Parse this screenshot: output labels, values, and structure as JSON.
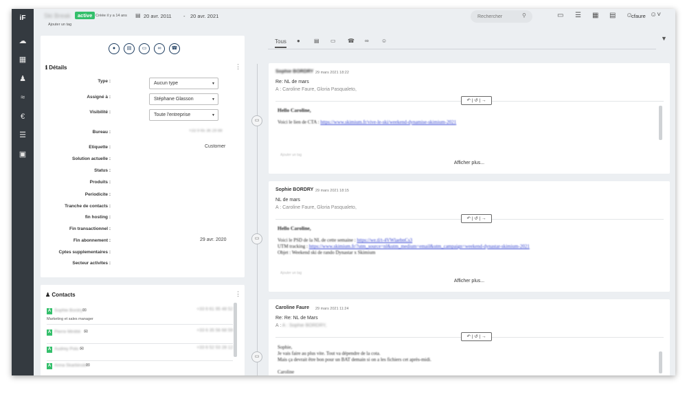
{
  "topbar": {
    "title": "Ski Break",
    "status": "active",
    "created": "Créée il y a 14 ans",
    "add_tag": "Ajouter un tag",
    "date_start": "20 avr. 2011",
    "date_sep": "-",
    "date_end": "20 avr. 2021",
    "search_placeholder": "Rechercher",
    "user": "cfaure"
  },
  "details": {
    "title": "Détails",
    "fields": [
      {
        "label": "Type :",
        "value": "Aucun type"
      },
      {
        "label": "Assigné à :",
        "value": "Stéphane Glasson"
      },
      {
        "label": "Visibilité :",
        "value": "Toute l'entreprise"
      },
      {
        "label": "Bureau :",
        "value": "+33 9 65 36 29 88"
      },
      {
        "label": "Etiquette :",
        "value": "Customer"
      },
      {
        "label": "Solution actuelle :",
        "value": ""
      },
      {
        "label": "Status :",
        "value": ""
      },
      {
        "label": "Produits :",
        "value": ""
      },
      {
        "label": "Periodicite :",
        "value": ""
      },
      {
        "label": "Tranche de contacts :",
        "value": ""
      },
      {
        "label": "fin hosting :",
        "value": ""
      },
      {
        "label": "Fin transactionnel :",
        "value": ""
      },
      {
        "label": "Fin abonnement :",
        "value": "29 avr. 2020"
      },
      {
        "label": "Cptes supplementaires :",
        "value": ""
      },
      {
        "label": "Secteur activites :",
        "value": ""
      }
    ]
  },
  "contacts": {
    "title": "Contacts",
    "items": [
      {
        "name": "Sophie Bordry",
        "phone": "+33 6 61 95 48 52",
        "role": "Marketing et sales manager"
      },
      {
        "name": "Pierre Minitté",
        "phone": "+33 6 35 56 68 59",
        "role": ""
      },
      {
        "name": "Audrey Polo",
        "phone": "+33 6 52 53 28 12",
        "role": ""
      },
      {
        "name": "Anna Skarbinski",
        "phone": "",
        "role": ""
      }
    ]
  },
  "tabs": [
    {
      "label": "Tous",
      "icon": ""
    },
    {
      "label": "",
      "icon": "comment-icon"
    },
    {
      "label": "",
      "icon": "calendar-icon"
    },
    {
      "label": "",
      "icon": "inbox-icon"
    },
    {
      "label": "",
      "icon": "phone-icon"
    },
    {
      "label": "",
      "icon": "paperclip-icon"
    },
    {
      "label": "",
      "icon": "user-icon"
    }
  ],
  "emails": [
    {
      "from": "Sophie BORDRY",
      "date": "29 mars 2021 18:22",
      "subject": "Re: NL de mars",
      "to": "A : Caroline Faure,  Gloria Pasqualeto,",
      "body_greeting": "Hello Caroline,",
      "body_lines": [
        "Voici le lien de CTA : "
      ],
      "body_link": "https://www.skimium.fr/vive-le-ski/weekend-dynamise-skimium-2021",
      "tag": "Ajouter un tag",
      "more": "Afficher plus..."
    },
    {
      "from": "Sophie BORDRY",
      "date": "29 mars 2021 18:15",
      "subject": "NL de mars",
      "to": "A : Caroline Faure,  Gloria Pasqualeto,",
      "body_greeting": "Hello Caroline,",
      "body_lines": [
        "Voici le PSD de la NL de cette semaine : ",
        "UTM tracking : ",
        "Objet : Weekend ski de rando Dynastar x Skimium"
      ],
      "body_link": "https://we.tl/t-4VWlaebnCs3",
      "body_link2": "https://www.skimium.fr/?utm_source=nl&utm_medium=email&utm_campaign=weekend-dynastar-skimium-2021",
      "tag": "Ajouter un tag",
      "more": "Afficher plus..."
    },
    {
      "from": "Caroline Faure",
      "date": "29 mars 2021 11:24",
      "subject": "Re: Re: NL de Mars",
      "to": "A : Sophie BORDRY,",
      "body_greeting": "Sophie,",
      "body_lines": [
        "Je vais faire au plus vite. Tout va dépendre de la cota.",
        "Mais ça devrait être bon pour un BAT demain si on a les fichiers cet après-midi.",
        "",
        "Caroline"
      ]
    }
  ],
  "colors": {
    "sidebar": "#343a40",
    "active_badge": "#34bf6b",
    "accent": "#1a3a5e"
  }
}
